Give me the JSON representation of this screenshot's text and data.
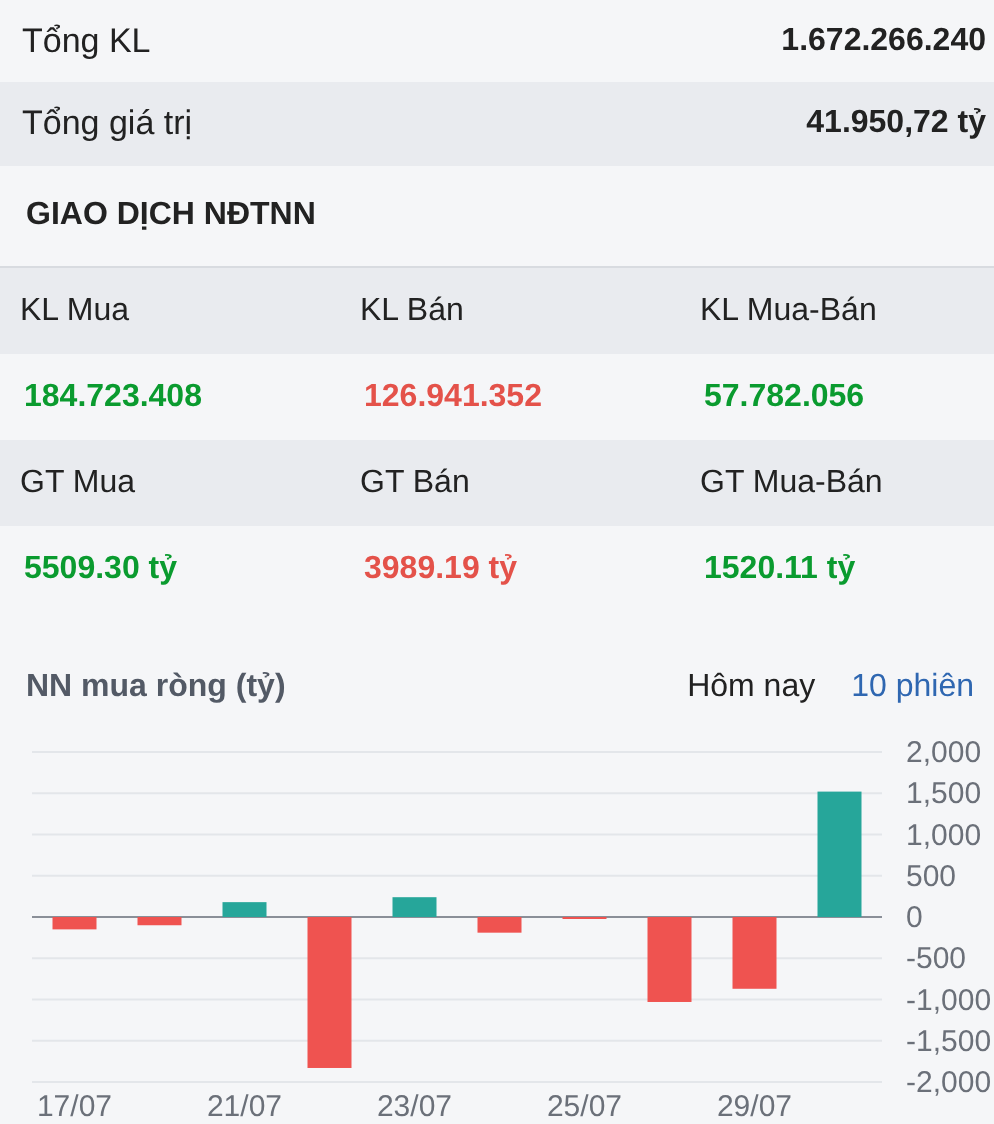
{
  "summary": [
    {
      "label": "Tổng KL",
      "value": "1.672.266.240"
    },
    {
      "label": "Tổng giá trị",
      "value": "41.950,72 tỷ"
    }
  ],
  "foreign_trading": {
    "title": "GIAO DỊCH NĐTNN",
    "groups": [
      {
        "cells": [
          {
            "label": "KL Mua",
            "value": "184.723.408",
            "color": "#0a9b2f"
          },
          {
            "label": "KL Bán",
            "value": "126.941.352",
            "color": "#e4524a"
          },
          {
            "label": "KL Mua-Bán",
            "value": "57.782.056",
            "color": "#0a9b2f"
          }
        ]
      },
      {
        "cells": [
          {
            "label": "GT Mua",
            "value": "5509.30 tỷ",
            "color": "#0a9b2f"
          },
          {
            "label": "GT Bán",
            "value": "3989.19 tỷ",
            "color": "#e4524a"
          },
          {
            "label": "GT Mua-Bán",
            "value": "1520.11 tỷ",
            "color": "#0a9b2f"
          }
        ]
      }
    ]
  },
  "net_buy": {
    "title": "NN mua ròng (tỷ)",
    "tabs": [
      {
        "label": "Hôm nay",
        "selected": false
      },
      {
        "label": "10 phiên",
        "selected": true
      }
    ],
    "chart_data": {
      "type": "bar",
      "categories": [
        "17/07",
        null,
        "21/07",
        null,
        "23/07",
        null,
        "25/07",
        null,
        "29/07",
        null
      ],
      "series": [
        {
          "color": "#26a69a",
          "values": [
            null,
            null,
            180,
            null,
            240,
            null,
            null,
            null,
            null,
            1520
          ]
        },
        {
          "color": "#ef5350",
          "values": [
            -150,
            -100,
            null,
            -1830,
            null,
            -190,
            -20,
            -1030,
            -870,
            null
          ]
        }
      ],
      "stacked": true,
      "grid": true,
      "ylim": [
        -2000,
        2000
      ],
      "yticks": [
        {
          "value": 2000,
          "label": "2,000"
        },
        {
          "value": 1500,
          "label": "1,500"
        },
        {
          "value": 1000,
          "label": "1,000"
        },
        {
          "value": 500,
          "label": "500"
        },
        {
          "value": 0,
          "label": "0"
        },
        {
          "value": -500,
          "label": "-500"
        },
        {
          "value": -1000,
          "label": "-1,000"
        },
        {
          "value": -1500,
          "label": "-1,500"
        },
        {
          "value": -2000,
          "label": "-2,000"
        }
      ]
    }
  }
}
